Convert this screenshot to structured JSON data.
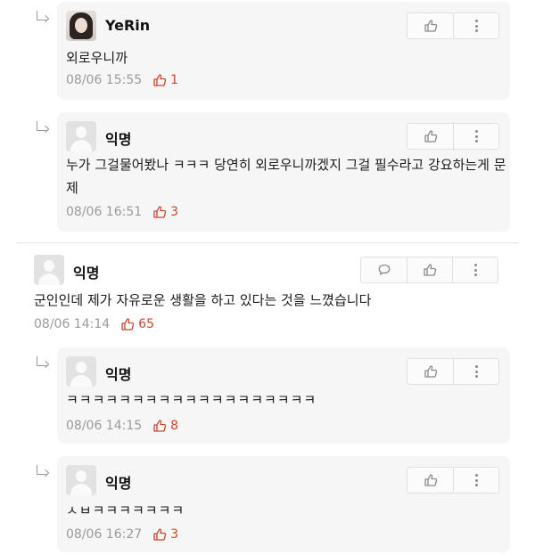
{
  "comments": [
    {
      "author": "YeRin",
      "text": "외로우니까",
      "time": "08/06 15:55",
      "likes": "1"
    },
    {
      "author": "익명",
      "text": "누가 그걸물어봤나 ㅋㅋㅋ 당연히 외로우니까겠지 그걸 필수라고 강요하는게 문제",
      "time": "08/06 16:51",
      "likes": "3"
    },
    {
      "author": "익명",
      "text": "군인인데 제가 자유로운 생활을 하고 있다는 것을 느꼈습니다",
      "time": "08/06 14:14",
      "likes": "65"
    },
    {
      "author": "익명",
      "text": "ㅋㅋㅋㅋㅋㅋㅋㅋㅋㅋㅋㅋㅋㅋㅋㅋㅋㅋㅋ",
      "time": "08/06 14:15",
      "likes": "8"
    },
    {
      "author": "익명",
      "text": "ㅅㅂㅋㅋㅋㅋㅋㅋㅋ",
      "time": "08/06 16:27",
      "likes": "3"
    }
  ],
  "icons": {
    "like": "thumbs-up-icon",
    "more": "more-vertical-icon",
    "reply": "speech-bubble-icon",
    "nested": "reply-arrow-icon"
  },
  "colors": {
    "like_count": "#c9482b",
    "meta": "#9a9a9a",
    "card": "#f6f6f6"
  }
}
